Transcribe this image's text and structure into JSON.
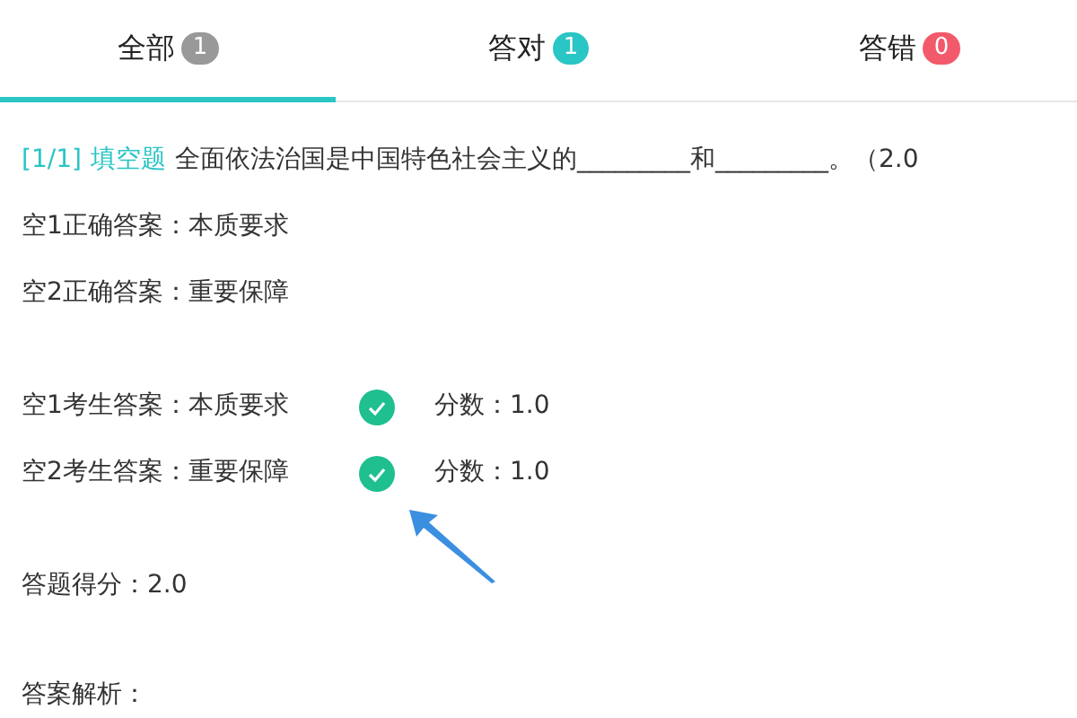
{
  "tabs": [
    {
      "label": "全部",
      "count": "1",
      "color": "#999999",
      "selected": true
    },
    {
      "label": "答对",
      "count": "1",
      "color": "#2ac5c5",
      "selected": false
    },
    {
      "label": "答错",
      "count": "0",
      "color": "#f25a6b",
      "selected": false
    }
  ],
  "question": {
    "index": "[1/1]",
    "type": "填空题",
    "text": "全面依法治国是中国特色社会主义的_________和_________。（2.0"
  },
  "correct_answers": [
    "空1正确答案：本质要求",
    "空2正确答案：重要保障"
  ],
  "student_answers": [
    {
      "text": "空1考生答案：本质要求",
      "correct": true,
      "score": "分数：1.0"
    },
    {
      "text": "空2考生答案：重要保障",
      "correct": true,
      "score": "分数：1.0"
    }
  ],
  "total_score": "答题得分：2.0",
  "analysis_label": "答案解析："
}
